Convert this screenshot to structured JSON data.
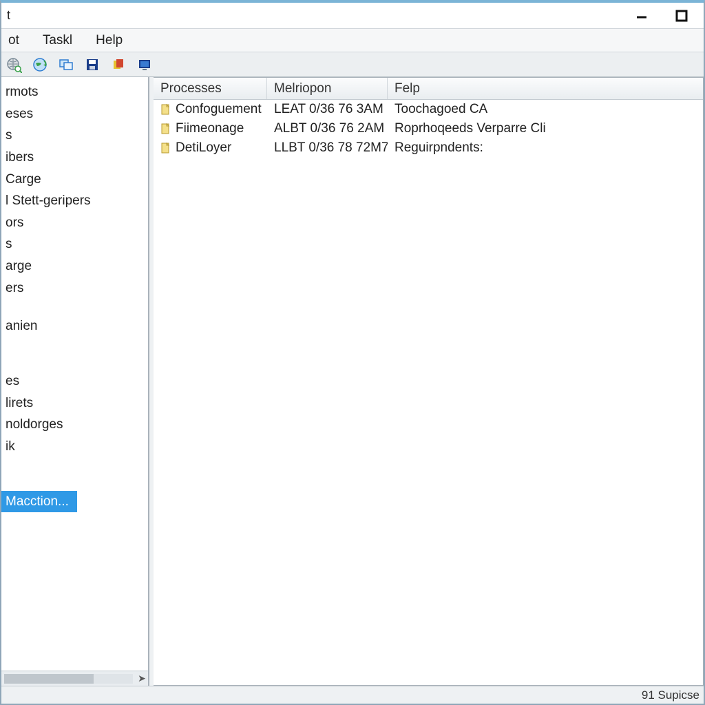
{
  "titlebar": {
    "title": "t"
  },
  "menubar": {
    "items": [
      "ot",
      "Taskl",
      "Help"
    ]
  },
  "toolbar": {
    "icons": [
      {
        "name": "globe-search-icon",
        "fg": "#5a6a78",
        "accent": "#3aa24a"
      },
      {
        "name": "globe-refresh-icon",
        "fg": "#2f7dd1",
        "accent": "#3aa24a"
      },
      {
        "name": "window-tile-icon",
        "fg": "#2f7dd1",
        "accent": "#2f7dd1"
      },
      {
        "name": "save-icon",
        "fg": "#1b3e8a",
        "accent": "#1b3e8a"
      },
      {
        "name": "shield-stack-icon",
        "fg": "#d1472f",
        "accent": "#e6c22f"
      },
      {
        "name": "monitor-icon",
        "fg": "#1b3e8a",
        "accent": "#2f7dd1"
      }
    ]
  },
  "sidebar": {
    "items": [
      "rmots",
      "eses",
      "s",
      "ibers",
      "  Carge",
      "l Stett-geripers",
      "ors",
      "s",
      "arge",
      "ers",
      "",
      "anien",
      "",
      "",
      "es",
      "lirets",
      "noldorges",
      "ik",
      "",
      ""
    ],
    "selected_index": 20,
    "selected_label": " Macction..."
  },
  "columns": {
    "c1": "Processes",
    "c2": "Melriopon",
    "c3": "Felp"
  },
  "rows": [
    {
      "name": "Confoguement",
      "col2": "LEAT 0/36 76 3AM",
      "col3": "Toochagoed CA"
    },
    {
      "name": "Fiimeonage",
      "col2": "ALBT 0/36 76 2AM",
      "col3": "Roprhoqeeds Verparre Cli"
    },
    {
      "name": "DetiLoyer",
      "col2": "LLBT 0/36 78 72M7",
      "col3": "Reguirpndents:"
    }
  ],
  "statusbar": {
    "right": "91 Supicse"
  }
}
